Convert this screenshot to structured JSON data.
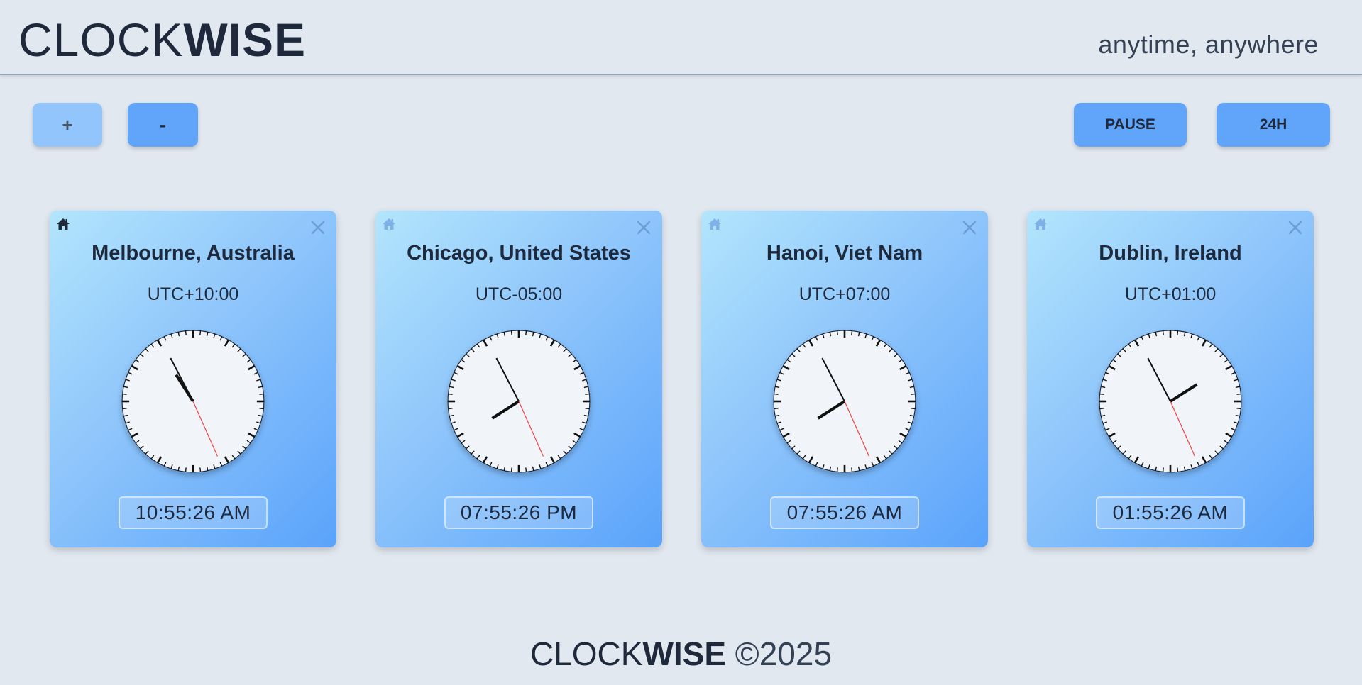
{
  "header": {
    "logo_light": "CLOCK",
    "logo_bold": "WISE",
    "tagline": "anytime, anywhere"
  },
  "toolbar": {
    "add_label": "+",
    "remove_label": "-",
    "pause_label": "PAUSE",
    "format_label": "24H"
  },
  "clocks": [
    {
      "city": "Melbourne, Australia",
      "utc": "UTC+10:00",
      "digital": "10:55:26 AM",
      "is_home": true,
      "hour": 10,
      "minute": 55,
      "second": 26
    },
    {
      "city": "Chicago, United States",
      "utc": "UTC-05:00",
      "digital": "07:55:26 PM",
      "is_home": false,
      "hour": 19,
      "minute": 55,
      "second": 26
    },
    {
      "city": "Hanoi, Viet Nam",
      "utc": "UTC+07:00",
      "digital": "07:55:26 AM",
      "is_home": false,
      "hour": 7,
      "minute": 55,
      "second": 26
    },
    {
      "city": "Dublin, Ireland",
      "utc": "UTC+01:00",
      "digital": "01:55:26 AM",
      "is_home": false,
      "hour": 1,
      "minute": 55,
      "second": 26
    }
  ],
  "icons": {
    "home": "home-icon",
    "close": "close-icon"
  },
  "colors": {
    "background": "#e2e8f0",
    "button": "#60a5fa",
    "button_disabled": "#93c5fd",
    "second_hand": "#ef4444",
    "home_active": "#1e293b",
    "home_inactive": "#7fb1e8"
  },
  "footer": {
    "logo_light": "CLOCK",
    "logo_bold": "WISE",
    "copyright": "©2025"
  }
}
